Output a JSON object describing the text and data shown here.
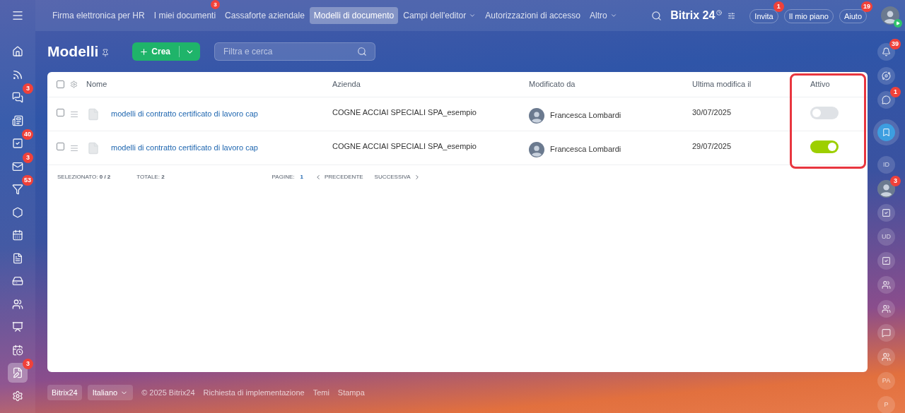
{
  "top_nav": {
    "tabs": [
      {
        "label": "Firma elettronica per HR",
        "selected": false,
        "dropdown": false
      },
      {
        "label": "I miei documenti",
        "selected": false,
        "dropdown": false,
        "badge": "3"
      },
      {
        "label": "Cassaforte aziendale",
        "selected": false,
        "dropdown": false
      },
      {
        "label": "Modelli di documento",
        "selected": true,
        "dropdown": false
      },
      {
        "label": "Campi dell'editor",
        "selected": false,
        "dropdown": true
      },
      {
        "label": "Autorizzazioni di accesso",
        "selected": false,
        "dropdown": false
      },
      {
        "label": "Altro",
        "selected": false,
        "dropdown": true
      }
    ],
    "brand": "Bitrix 24",
    "buttons": [
      {
        "label": "Invita",
        "badge": "1"
      },
      {
        "label": "Il mio piano"
      },
      {
        "label": "Aiuto",
        "badge": "19"
      }
    ]
  },
  "left_sidebar": [
    {
      "selected": false
    },
    {
      "selected": false
    },
    {
      "selected": false,
      "badge": "3"
    },
    {
      "selected": false
    },
    {
      "selected": false,
      "badge": "40"
    },
    {
      "selected": false,
      "badge": "3"
    },
    {
      "selected": false,
      "badge": "53"
    },
    {
      "selected": false
    },
    {
      "selected": false
    },
    {
      "selected": false
    },
    {
      "selected": false
    },
    {
      "selected": false
    },
    {
      "selected": false
    },
    {
      "selected": false
    },
    {
      "selected": true,
      "badge": "3"
    },
    {
      "selected": false
    }
  ],
  "right_sidebar": [
    {
      "kind": "icon",
      "selected": false,
      "badge": "39"
    },
    {
      "kind": "icon",
      "selected": false
    },
    {
      "kind": "icon",
      "selected": false,
      "badge": "1"
    },
    {
      "kind": "icon",
      "selected": true
    },
    {
      "kind": "initials",
      "selected": false,
      "text": "ID"
    },
    {
      "kind": "avatar",
      "selected": false,
      "badge": "3"
    },
    {
      "kind": "icon",
      "selected": false
    },
    {
      "kind": "initials",
      "selected": false,
      "text": "UD"
    },
    {
      "kind": "icon",
      "selected": false
    },
    {
      "kind": "icon",
      "selected": false
    },
    {
      "kind": "icon",
      "selected": false
    },
    {
      "kind": "icon",
      "selected": false
    },
    {
      "kind": "icon",
      "selected": false
    },
    {
      "kind": "initials",
      "selected": false,
      "text": "PA"
    },
    {
      "kind": "initials",
      "selected": false,
      "text": "P"
    }
  ],
  "page": {
    "title": "Modelli",
    "create_button": "Crea",
    "search": {
      "placeholder": "Filtra e cerca"
    }
  },
  "table": {
    "header_checked": false,
    "last_column_framed": true,
    "columns": [
      {
        "label": "Nome"
      },
      {
        "label": "Azienda"
      },
      {
        "label": "Modificato da"
      },
      {
        "label": "Ultima modifica il"
      },
      {
        "label": "Attivo"
      }
    ],
    "rows": [
      {
        "name": "modelli di contratto certificato di lavoro cap",
        "company": "COGNE ACCIAI SPECIALI SPA_esempio",
        "modified_by": "Francesca Lombardi",
        "date": "30/07/2025",
        "active": false,
        "checked": false
      },
      {
        "name": "modelli di contratto certificato di lavoro cap",
        "company": "COGNE ACCIAI SPECIALI SPA_esempio",
        "modified_by": "Francesca Lombardi",
        "date": "29/07/2025",
        "active": true,
        "checked": false
      }
    ],
    "footer": {
      "selected_label": "SELEZIONATO:",
      "selected_value": "0 / 2",
      "total_label": "TOTALE:",
      "total_value": "2",
      "pages_label": "PAGINE:",
      "page": "1",
      "prev": "PRECEDENTE",
      "next": "SUCCESSIVA"
    }
  },
  "footer": {
    "brand": "Bitrix24",
    "language": "Italiano",
    "links": [
      "© 2025 Bitrix24",
      "Richiesta di implementazione",
      "Temi",
      "Stampa"
    ]
  }
}
